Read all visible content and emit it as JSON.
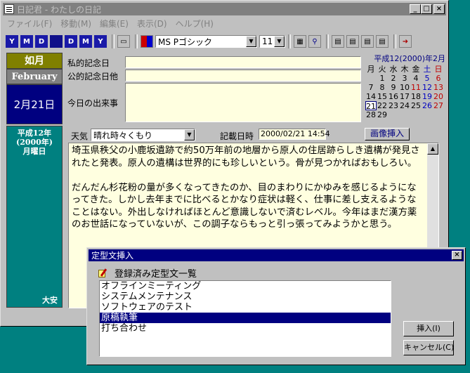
{
  "window": {
    "title": "日記君 - わたしの日記",
    "btn_min": "_",
    "btn_max": "□",
    "btn_close": "×"
  },
  "menu": [
    "ファイル(F)",
    "移動(M)",
    "編集(E)",
    "表示(D)",
    "ヘルプ(H)"
  ],
  "toolbar": {
    "font_name": "MS Pゴシック",
    "font_size": "11",
    "nav_letters": [
      "Y",
      "M",
      "D",
      "D",
      "M",
      "Y"
    ]
  },
  "left_panel": {
    "month_jp": "如月",
    "month_en": "February",
    "date": "2月21日",
    "era_lines": [
      "平成12年",
      "(2000年)",
      "月曜日"
    ],
    "rokuyo": "大安"
  },
  "fields": {
    "private_anniv_label": "私的記念日",
    "public_anniv_label": "公的記念日他",
    "today_label": "今日の出来事",
    "private_anniv_value": "",
    "public_anniv_value": "",
    "today_value": ""
  },
  "calendar": {
    "header": "平成12(2000)年2月",
    "weekdays": [
      "月",
      "火",
      "水",
      "木",
      "金",
      "土",
      "日"
    ],
    "days": [
      "",
      "1",
      "2",
      "3",
      "4",
      "5",
      "6",
      "7",
      "8",
      "9",
      "10",
      "11",
      "12",
      "13",
      "14",
      "15",
      "16",
      "17",
      "18",
      "19",
      "20",
      "21",
      "22",
      "23",
      "24",
      "25",
      "26",
      "27",
      "28",
      "29",
      "",
      "",
      "",
      "",
      ""
    ],
    "today": "21",
    "holidays": [
      "11"
    ],
    "colors": {
      "saturday": "#0000c0",
      "sunday": "#c00000",
      "today_border": "#000080"
    }
  },
  "entry": {
    "weather_label": "天気",
    "weather_value": "晴れ時々くもり",
    "record_label": "記載日時",
    "record_value": "2000/02/21 14:54",
    "image_button": "画像挿入",
    "text": "埼玉県秩父の小鹿坂遺跡で約50万年前の地層から原人の住居跡らしき遺構が発見されたと発表。原人の遺構は世界的にも珍しいという。骨が見つかればおもしろい。\n\nだんだん杉花粉の量が多くなってきたのか、目のまわりにかゆみを感じるようになってきた。しかし去年までに比べるとかなり症状は軽く、仕事に差し支えるようなことはない。外出しなければほとんど意識しないで済むレベル。今年はまだ漢方薬のお世話になっていないが、この調子ならもっと引っ張ってみようかと思う。"
  },
  "dialog": {
    "title": "定型文挿入",
    "close": "×",
    "list_title": "登録済み定型文一覧",
    "items": [
      "オフラインミーティング",
      "システムメンテナンス",
      "ソフトウェアのテスト",
      "原稿執筆",
      "打ち合わせ"
    ],
    "selected_index": 3,
    "insert_button": "挿入(I)",
    "cancel_button": "キャンセル(C)"
  }
}
